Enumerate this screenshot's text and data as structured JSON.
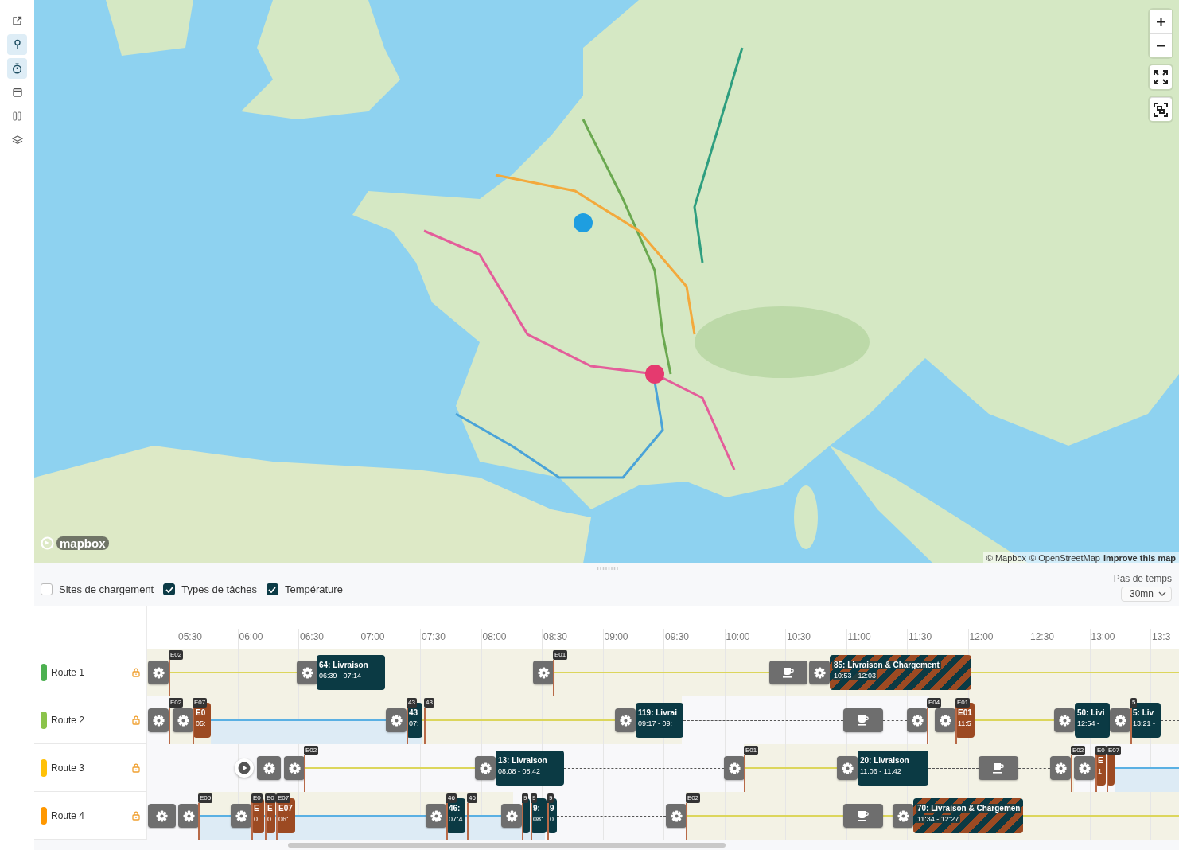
{
  "sidebar": {
    "items": [
      {
        "selected": false
      },
      {
        "selected": true
      },
      {
        "selected": true
      },
      {
        "selected": false
      },
      {
        "selected": false
      },
      {
        "selected": false
      }
    ]
  },
  "map": {
    "logo": "mapbox",
    "attribution": [
      "© Mapbox",
      "© OpenStreetMap"
    ],
    "improve_link": "Improve this map"
  },
  "filters": [
    {
      "label": "Sites de chargement",
      "checked": false
    },
    {
      "label": "Types de tâches",
      "checked": true
    },
    {
      "label": "Température",
      "checked": true
    }
  ],
  "time_step": {
    "label": "Pas de temps",
    "value": "30mn"
  },
  "timeline": {
    "ticks": [
      "05:30",
      "06:00",
      "06:30",
      "07:00",
      "07:30",
      "08:00",
      "08:30",
      "09:00",
      "09:30",
      "10:00",
      "10:30",
      "11:00",
      "11:30",
      "12:00",
      "12:30",
      "13:00",
      "13:3"
    ],
    "routes": [
      {
        "name": "Route 1",
        "color": "#4cb050",
        "items": [
          {
            "kind": "gear"
          },
          {
            "kind": "flag",
            "label": "E02"
          },
          {
            "kind": "gear"
          },
          {
            "kind": "delivery",
            "title": "64: Livraison",
            "time": "06:39 - 07:14"
          },
          {
            "kind": "gear"
          },
          {
            "kind": "flag",
            "label": "E01"
          },
          {
            "kind": "break"
          },
          {
            "kind": "gear"
          },
          {
            "kind": "mixed",
            "title": "85: Livraison & Chargement",
            "time": "10:53 - 12:03"
          }
        ]
      },
      {
        "name": "Route 2",
        "color": "#8bc34a",
        "items": [
          {
            "kind": "gear"
          },
          {
            "kind": "flag",
            "label": "E02"
          },
          {
            "kind": "gear"
          },
          {
            "kind": "flag",
            "label": "E07"
          },
          {
            "kind": "loading",
            "title": "E0",
            "time": "05:"
          },
          {
            "kind": "gear"
          },
          {
            "kind": "flag",
            "label": "43"
          },
          {
            "kind": "delivery",
            "title": "43",
            "time": "07:"
          },
          {
            "kind": "flag",
            "label": "43"
          },
          {
            "kind": "gear"
          },
          {
            "kind": "delivery",
            "title": "119: Livrai",
            "time": "09:17 - 09:"
          },
          {
            "kind": "break"
          },
          {
            "kind": "gear"
          },
          {
            "kind": "flag",
            "label": "E04"
          },
          {
            "kind": "gear"
          },
          {
            "kind": "flag",
            "label": "E01"
          },
          {
            "kind": "loading",
            "title": "E01",
            "time": "11:5"
          },
          {
            "kind": "gear"
          },
          {
            "kind": "delivery",
            "title": "50: Livi",
            "time": "12:54 -"
          },
          {
            "kind": "gear"
          },
          {
            "kind": "flag",
            "label": "5"
          },
          {
            "kind": "delivery",
            "title": "5: Liv",
            "time": "13:21 -"
          }
        ]
      },
      {
        "name": "Route 3",
        "color": "#ffc107",
        "items": [
          {
            "kind": "start"
          },
          {
            "kind": "gear"
          },
          {
            "kind": "gear"
          },
          {
            "kind": "flag",
            "label": "E02"
          },
          {
            "kind": "gear"
          },
          {
            "kind": "delivery",
            "title": "13: Livraison",
            "time": "08:08 - 08:42"
          },
          {
            "kind": "gear"
          },
          {
            "kind": "flag",
            "label": "E01"
          },
          {
            "kind": "gear"
          },
          {
            "kind": "delivery",
            "title": "20: Livraison",
            "time": "11:06 - 11:42"
          },
          {
            "kind": "break"
          },
          {
            "kind": "gear"
          },
          {
            "kind": "flag",
            "label": "E02"
          },
          {
            "kind": "gear"
          },
          {
            "kind": "flag",
            "label": "E0"
          },
          {
            "kind": "loading",
            "title": "E",
            "time": "1"
          },
          {
            "kind": "flag",
            "label": "E07"
          },
          {
            "kind": "loading"
          }
        ]
      },
      {
        "name": "Route 4",
        "color": "#ff9800",
        "items": [
          {
            "kind": "gear"
          },
          {
            "kind": "gear"
          },
          {
            "kind": "flag",
            "label": "E05"
          },
          {
            "kind": "gear"
          },
          {
            "kind": "flag",
            "label": "E0"
          },
          {
            "kind": "loading",
            "title": "E",
            "time": "0"
          },
          {
            "kind": "flag",
            "label": "E0"
          },
          {
            "kind": "loading",
            "title": "E",
            "time": "0"
          },
          {
            "kind": "flag",
            "label": "E07"
          },
          {
            "kind": "loading",
            "title": "E07",
            "time": "06:"
          },
          {
            "kind": "gear"
          },
          {
            "kind": "flag",
            "label": "46"
          },
          {
            "kind": "delivery",
            "title": "46:",
            "time": "07:4"
          },
          {
            "kind": "flag",
            "label": "46"
          },
          {
            "kind": "gear"
          },
          {
            "kind": "flag",
            "label": "9"
          },
          {
            "kind": "delivery"
          },
          {
            "kind": "flag",
            "label": "9"
          },
          {
            "kind": "delivery",
            "title": "9:",
            "time": "08:"
          },
          {
            "kind": "flag",
            "label": "9"
          },
          {
            "kind": "delivery",
            "title": "9",
            "time": "0"
          },
          {
            "kind": "gear"
          },
          {
            "kind": "flag",
            "label": "E02"
          },
          {
            "kind": "break"
          },
          {
            "kind": "gear"
          },
          {
            "kind": "mixed",
            "title": "70: Livraison & Chargemen",
            "time": "11:34 - 12:27"
          }
        ]
      }
    ]
  }
}
